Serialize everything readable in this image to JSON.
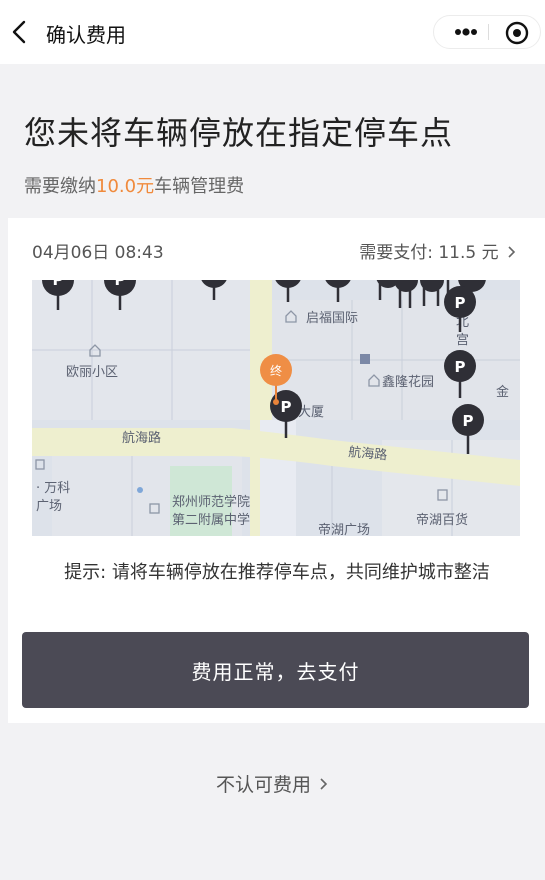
{
  "nav": {
    "title": "确认费用"
  },
  "headline": "您未将车辆停放在指定停车点",
  "fee_notice": {
    "prefix": "需要缴纳",
    "amount": "10.0元",
    "suffix": "车辆管理费"
  },
  "card": {
    "date": "04月06日 08:43",
    "pay_label": "需要支付: 11.5 元",
    "hint": "提示: 请将车辆停放在推荐停车点，共同维护城市整洁",
    "pay_button": "费用正常，去支付"
  },
  "map": {
    "labels": {
      "qifu": "启福国际",
      "ouli": "欧丽小区",
      "xinlong": "鑫隆花园",
      "jin": "金",
      "dasha": "大厦",
      "hanghai1": "航海路",
      "hanghai2": "航海路",
      "wanke1": "· 万科",
      "wanke2": "广场",
      "school1": "郑州师范学院",
      "school2": "第二附属中学",
      "dihu_plaza": "帝湖广场",
      "dihu_store": "帝湖百货",
      "bei": "北",
      "gong": "宫",
      "end_marker": "终",
      "parking": "P"
    }
  },
  "reject_link": "不认可费用"
}
